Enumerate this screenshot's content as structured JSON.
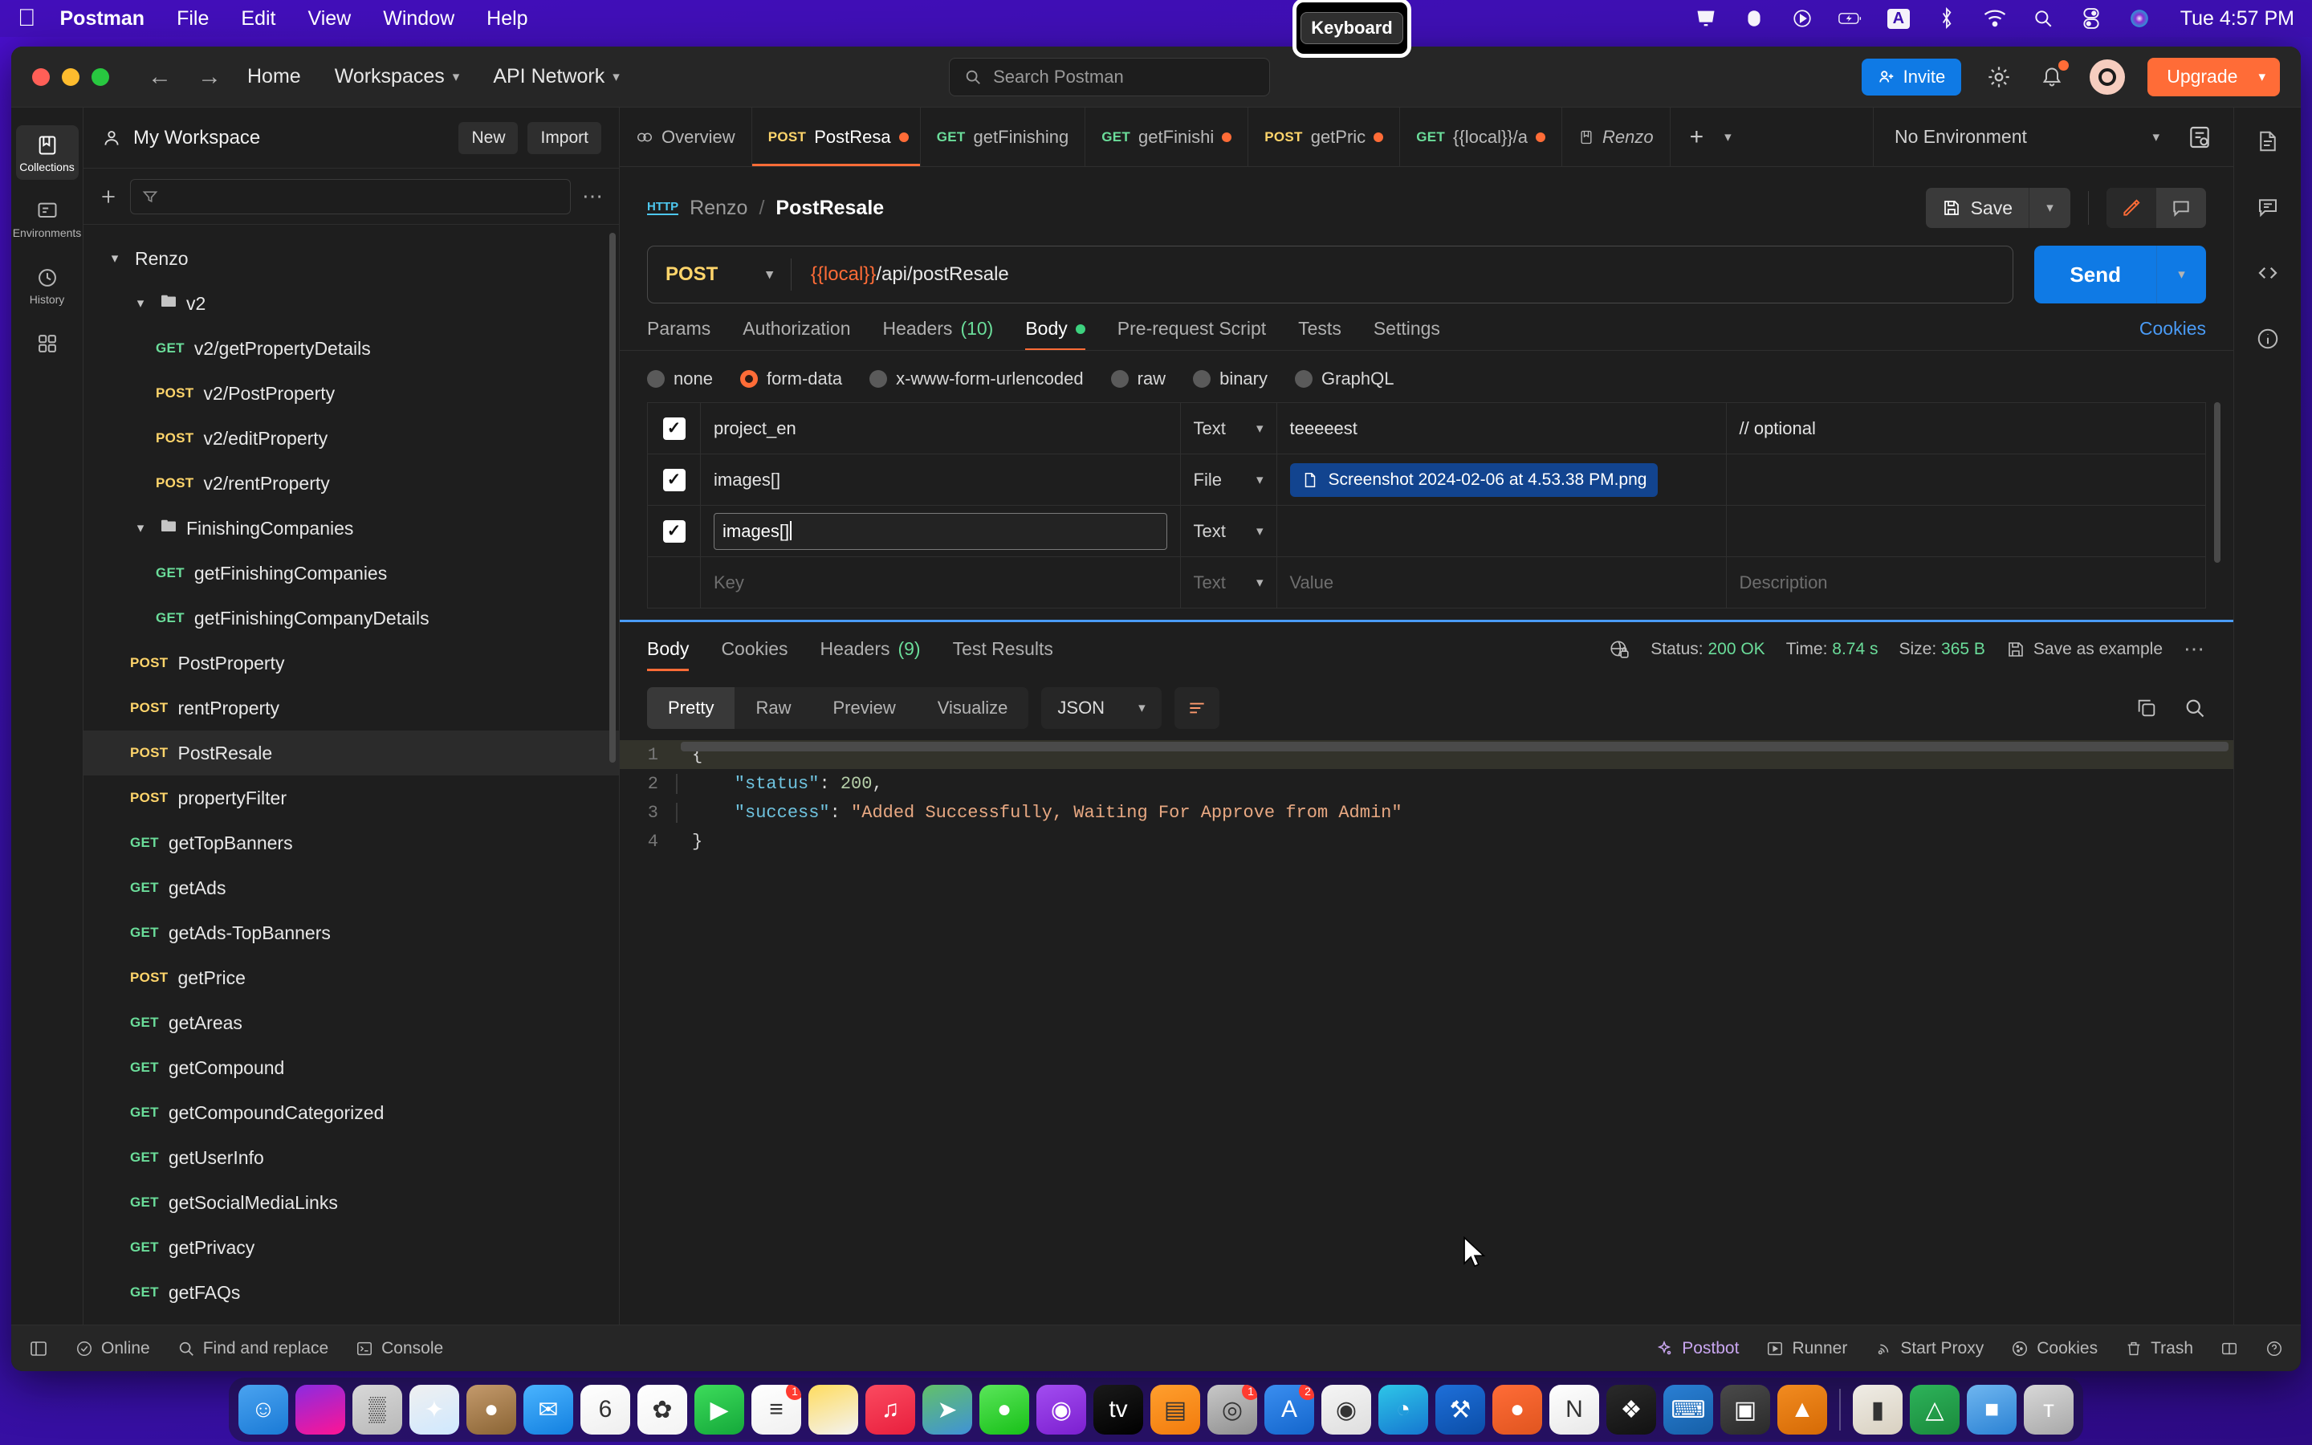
{
  "macos": {
    "apple_icon": "apple-logo",
    "menus": [
      "Postman",
      "File",
      "Edit",
      "View",
      "Window",
      "Help"
    ],
    "status_icons": [
      "display-icon",
      "dropbox-icon",
      "play-icon",
      "battery-charging-icon",
      "keyboard-input-icon",
      "bluetooth-icon",
      "wifi-icon",
      "spotlight-search-icon",
      "control-center-icon",
      "siri-icon"
    ],
    "input_letter": "A",
    "clock": "Tue 4:57 PM",
    "tooltip": "Keyboard"
  },
  "titlebar": {
    "back": "←",
    "forward": "→",
    "home": "Home",
    "workspaces": "Workspaces",
    "api_network": "API Network",
    "search_placeholder": "Search Postman",
    "invite": "Invite",
    "upgrade": "Upgrade"
  },
  "rail": {
    "items": [
      {
        "label": "Collections",
        "icon": "collections-icon"
      },
      {
        "label": "Environments",
        "icon": "environments-icon"
      },
      {
        "label": "History",
        "icon": "history-icon"
      },
      {
        "label": "",
        "icon": "apps-grid-icon"
      }
    ]
  },
  "sidebar": {
    "workspace": "My Workspace",
    "new_button": "New",
    "import_button": "Import",
    "filter_placeholder": "",
    "tree": [
      {
        "label": "Renzo",
        "kind": "collection",
        "depth": 0,
        "expanded": true
      },
      {
        "label": "v2",
        "kind": "folder",
        "depth": 1,
        "expanded": true
      },
      {
        "label": "v2/getPropertyDetails",
        "kind": "request",
        "method": "GET",
        "depth": 2
      },
      {
        "label": "v2/PostProperty",
        "kind": "request",
        "method": "POST",
        "depth": 2
      },
      {
        "label": "v2/editProperty",
        "kind": "request",
        "method": "POST",
        "depth": 2
      },
      {
        "label": "v2/rentProperty",
        "kind": "request",
        "method": "POST",
        "depth": 2
      },
      {
        "label": "FinishingCompanies",
        "kind": "folder",
        "depth": 1,
        "expanded": true
      },
      {
        "label": "getFinishingCompanies",
        "kind": "request",
        "method": "GET",
        "depth": 2
      },
      {
        "label": "getFinishingCompanyDetails",
        "kind": "request",
        "method": "GET",
        "depth": 2
      },
      {
        "label": "PostProperty",
        "kind": "request",
        "method": "POST",
        "depth": 1
      },
      {
        "label": "rentProperty",
        "kind": "request",
        "method": "POST",
        "depth": 1
      },
      {
        "label": "PostResale",
        "kind": "request",
        "method": "POST",
        "depth": 1,
        "selected": true
      },
      {
        "label": "propertyFilter",
        "kind": "request",
        "method": "POST",
        "depth": 1
      },
      {
        "label": "getTopBanners",
        "kind": "request",
        "method": "GET",
        "depth": 1
      },
      {
        "label": "getAds",
        "kind": "request",
        "method": "GET",
        "depth": 1
      },
      {
        "label": "getAds-TopBanners",
        "kind": "request",
        "method": "GET",
        "depth": 1
      },
      {
        "label": "getPrice",
        "kind": "request",
        "method": "POST",
        "depth": 1
      },
      {
        "label": "getAreas",
        "kind": "request",
        "method": "GET",
        "depth": 1
      },
      {
        "label": "getCompound",
        "kind": "request",
        "method": "GET",
        "depth": 1
      },
      {
        "label": "getCompoundCategorized",
        "kind": "request",
        "method": "GET",
        "depth": 1
      },
      {
        "label": "getUserInfo",
        "kind": "request",
        "method": "GET",
        "depth": 1
      },
      {
        "label": "getSocialMediaLinks",
        "kind": "request",
        "method": "GET",
        "depth": 1
      },
      {
        "label": "getPrivacy",
        "kind": "request",
        "method": "GET",
        "depth": 1
      },
      {
        "label": "getFAQs",
        "kind": "request",
        "method": "GET",
        "depth": 1
      }
    ]
  },
  "tabs": {
    "items": [
      {
        "label": "Overview",
        "method": "",
        "dirty": false,
        "active": false,
        "icon": "overview-icon"
      },
      {
        "label": "PostResa",
        "method": "POST",
        "dirty": true,
        "active": true
      },
      {
        "label": "getFinishing",
        "method": "GET",
        "dirty": false,
        "active": false
      },
      {
        "label": "getFinishi",
        "method": "GET",
        "dirty": true,
        "active": false
      },
      {
        "label": "getPric",
        "method": "POST",
        "dirty": true,
        "active": false
      },
      {
        "label": "{{local}}/a",
        "method": "GET",
        "dirty": true,
        "active": false
      },
      {
        "label": "Renzo",
        "method": "",
        "dirty": false,
        "active": false,
        "icon": "collection-tab-icon"
      }
    ],
    "new_tab": "+",
    "environment": "No Environment"
  },
  "request": {
    "breadcrumb_root": "Renzo",
    "breadcrumb_sep": "/",
    "breadcrumb_current": "PostResale",
    "protocol_badge": "HTTP",
    "save_label": "Save",
    "method": "POST",
    "url_variable": "{{local}}",
    "url_path": "/api/postResale",
    "send_label": "Send",
    "cookies_link": "Cookies",
    "tabs": [
      {
        "label": "Params",
        "active": false
      },
      {
        "label": "Authorization",
        "active": false
      },
      {
        "label": "Headers",
        "count": "(10)",
        "active": false
      },
      {
        "label": "Body",
        "active": true,
        "dot": true
      },
      {
        "label": "Pre-request Script",
        "active": false
      },
      {
        "label": "Tests",
        "active": false
      },
      {
        "label": "Settings",
        "active": false
      }
    ],
    "body_types": [
      {
        "label": "none",
        "selected": false
      },
      {
        "label": "form-data",
        "selected": true
      },
      {
        "label": "x-www-form-urlencoded",
        "selected": false
      },
      {
        "label": "raw",
        "selected": false
      },
      {
        "label": "binary",
        "selected": false
      },
      {
        "label": "GraphQL",
        "selected": false
      }
    ],
    "form_columns": [
      "Key",
      "Text",
      "Value",
      "Description"
    ],
    "form_rows": [
      {
        "checked": true,
        "key": "project_en",
        "type": "Text",
        "value": "teeeeest",
        "description": "// optional",
        "value_kind": "text"
      },
      {
        "checked": true,
        "key": "images[]",
        "type": "File",
        "value": "Screenshot 2024-02-06 at 4.53.38 PM.png",
        "description": "",
        "value_kind": "file"
      },
      {
        "checked": true,
        "key": "images[]",
        "type": "Text",
        "value": "",
        "description": "",
        "value_kind": "text",
        "editing": true
      },
      {
        "checked": false,
        "key": "Key",
        "type": "Text",
        "value": "Value",
        "description": "Description",
        "value_kind": "placeholder"
      }
    ]
  },
  "response": {
    "tabs": [
      {
        "label": "Body",
        "active": true
      },
      {
        "label": "Cookies",
        "active": false
      },
      {
        "label": "Headers",
        "count": "(9)",
        "active": false
      },
      {
        "label": "Test Results",
        "active": false
      }
    ],
    "status_label": "Status:",
    "status_value": "200 OK",
    "time_label": "Time:",
    "time_value": "8.74 s",
    "size_label": "Size:",
    "size_value": "365 B",
    "save_example": "Save as example",
    "views": [
      "Pretty",
      "Raw",
      "Preview",
      "Visualize"
    ],
    "active_view": "Pretty",
    "format": "JSON",
    "lines": [
      {
        "no": "1",
        "tokens": [
          {
            "t": "{",
            "c": "p"
          }
        ],
        "highlight": true
      },
      {
        "no": "2",
        "tokens": [
          {
            "t": "    \"status\"",
            "c": "k"
          },
          {
            "t": ": ",
            "c": "p"
          },
          {
            "t": "200",
            "c": "n"
          },
          {
            "t": ",",
            "c": "p"
          }
        ]
      },
      {
        "no": "3",
        "tokens": [
          {
            "t": "    \"success\"",
            "c": "k"
          },
          {
            "t": ": ",
            "c": "p"
          },
          {
            "t": "\"Added Successfully, Waiting For Approve from Admin\"",
            "c": "s"
          }
        ]
      },
      {
        "no": "4",
        "tokens": [
          {
            "t": "}",
            "c": "p"
          }
        ]
      }
    ]
  },
  "statusbar": {
    "left": [
      {
        "label": "",
        "icon": "sidebar-toggle-icon"
      },
      {
        "label": "Online",
        "icon": "online-icon"
      },
      {
        "label": "Find and replace",
        "icon": "search-icon"
      },
      {
        "label": "Console",
        "icon": "console-icon"
      }
    ],
    "right": [
      {
        "label": "Postbot",
        "icon": "postbot-icon"
      },
      {
        "label": "Runner",
        "icon": "runner-icon"
      },
      {
        "label": "Start Proxy",
        "icon": "proxy-icon"
      },
      {
        "label": "Cookies",
        "icon": "cookies-icon"
      },
      {
        "label": "Trash",
        "icon": "trash-icon"
      },
      {
        "label": "",
        "icon": "layout-icon"
      },
      {
        "label": "",
        "icon": "help-icon"
      }
    ]
  },
  "dock": {
    "apps": [
      {
        "name": "Finder",
        "color1": "#4aa3f0",
        "color2": "#1a7ad6",
        "glyph": "☺"
      },
      {
        "name": "Siri",
        "color1": "#8a2be2",
        "color2": "#ff1493",
        "glyph": ""
      },
      {
        "name": "Launchpad",
        "color1": "#d8d8d8",
        "color2": "#b8b8b8",
        "glyph": "▒"
      },
      {
        "name": "Safari",
        "color1": "#f0f0f0",
        "color2": "#cfe8ff",
        "glyph": "✦"
      },
      {
        "name": "Contacts",
        "color1": "#c49a6c",
        "color2": "#8a6434",
        "glyph": "●"
      },
      {
        "name": "Mail",
        "color1": "#4ab4ff",
        "color2": "#1380e0",
        "glyph": "✉"
      },
      {
        "name": "Calendar",
        "color1": "#ffffff",
        "color2": "#eeeeee",
        "glyph": "6",
        "badge": ""
      },
      {
        "name": "Photos",
        "color1": "#ffffff",
        "color2": "#f3f3f3",
        "glyph": "✿"
      },
      {
        "name": "FaceTime",
        "color1": "#3ddc5b",
        "color2": "#14a83a",
        "glyph": "▶"
      },
      {
        "name": "Reminders",
        "color1": "#ffffff",
        "color2": "#f0f0f0",
        "glyph": "≡",
        "badge": "1"
      },
      {
        "name": "Notes",
        "color1": "#ffdc5e",
        "color2": "#f3f3f3",
        "glyph": ""
      },
      {
        "name": "Music",
        "color1": "#fb4a60",
        "color2": "#e81f3d",
        "glyph": "♫"
      },
      {
        "name": "Maps",
        "color1": "#63c168",
        "color2": "#3f92d8",
        "glyph": "➤"
      },
      {
        "name": "Messages",
        "color1": "#5ae65a",
        "color2": "#18c018",
        "glyph": "●"
      },
      {
        "name": "Podcasts",
        "color1": "#a24df0",
        "color2": "#7c1fd0",
        "glyph": "◉"
      },
      {
        "name": "Apple TV",
        "color1": "#1a1a1a",
        "color2": "#000000",
        "glyph": "tv"
      },
      {
        "name": "Books",
        "color1": "#ff9f2e",
        "color2": "#f27b0c",
        "glyph": "▤"
      },
      {
        "name": "App Store Old",
        "color1": "#c8c8c8",
        "color2": "#8f8f8f",
        "glyph": "◎",
        "badge": "1"
      },
      {
        "name": "App Store",
        "color1": "#3a8ef0",
        "color2": "#1466cc",
        "glyph": "A",
        "badge": "2"
      },
      {
        "name": "Chrome",
        "color1": "#f5f5f5",
        "color2": "#dedede",
        "glyph": "◉"
      },
      {
        "name": "Edge",
        "color1": "#2ec6e8",
        "color2": "#1577d0",
        "glyph": "◔"
      },
      {
        "name": "Xcode",
        "color1": "#1e6fd9",
        "color2": "#0b4ea8",
        "glyph": "⚒"
      },
      {
        "name": "Postman",
        "color1": "#ff6c37",
        "color2": "#e0551f",
        "glyph": "●"
      },
      {
        "name": "Notion",
        "color1": "#ffffff",
        "color2": "#e8e8e8",
        "glyph": "N"
      },
      {
        "name": "Figma",
        "color1": "#2a2a2a",
        "color2": "#111111",
        "glyph": "❖"
      },
      {
        "name": "VS Code",
        "color1": "#2a7fd4",
        "color2": "#1660a8",
        "glyph": "⌨"
      },
      {
        "name": "Screenshot",
        "color1": "#4a4a4a",
        "color2": "#2a2a2a",
        "glyph": "▣"
      },
      {
        "name": "VLC",
        "color1": "#f28b20",
        "color2": "#d56a05",
        "glyph": "▲"
      },
      {
        "name": "Sep",
        "color1": "",
        "color2": "",
        "glyph": ""
      },
      {
        "name": "Terminal",
        "color1": "#f0ede6",
        "color2": "#d8d0c0",
        "glyph": "▮"
      },
      {
        "name": "Android Studio",
        "color1": "#2db35a",
        "color2": "#1a8a3c",
        "glyph": "△"
      },
      {
        "name": "Finder2",
        "color1": "#6fb6f0",
        "color2": "#2b82d4",
        "glyph": "■"
      },
      {
        "name": "Trash",
        "color1": "#d8d8d8",
        "color2": "#a8a8a8",
        "glyph": "ᴛ"
      }
    ]
  }
}
